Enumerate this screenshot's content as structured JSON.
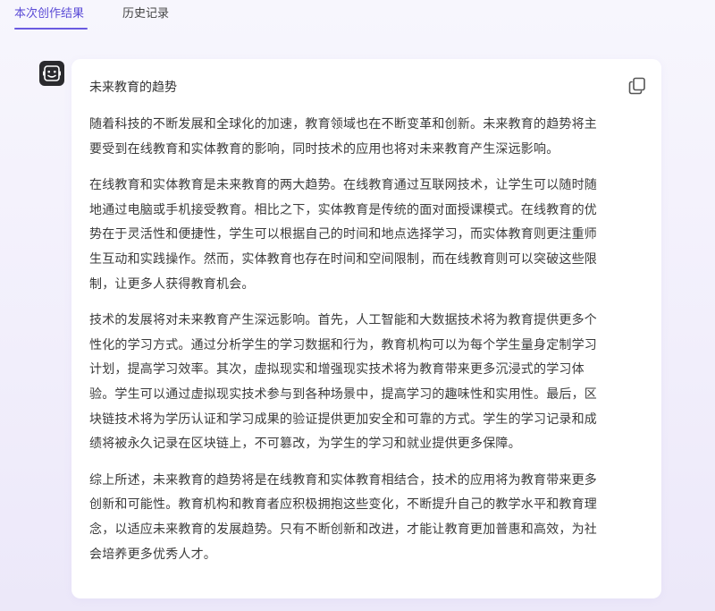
{
  "tabs": [
    {
      "label": "本次创作结果",
      "active": true
    },
    {
      "label": "历史记录",
      "active": false
    }
  ],
  "accent_color": "#6a5ae0",
  "result": {
    "title": "未来教育的趋势",
    "paragraphs": [
      "随着科技的不断发展和全球化的加速，教育领域也在不断变革和创新。未来教育的趋势将主要受到在线教育和实体教育的影响，同时技术的应用也将对未来教育产生深远影响。",
      "在线教育和实体教育是未来教育的两大趋势。在线教育通过互联网技术，让学生可以随时随地通过电脑或手机接受教育。相比之下，实体教育是传统的面对面授课模式。在线教育的优势在于灵活性和便捷性，学生可以根据自己的时间和地点选择学习，而实体教育则更注重师生互动和实践操作。然而，实体教育也存在时间和空间限制，而在线教育则可以突破这些限制，让更多人获得教育机会。",
      "技术的发展将对未来教育产生深远影响。首先，人工智能和大数据技术将为教育提供更多个性化的学习方式。通过分析学生的学习数据和行为，教育机构可以为每个学生量身定制学习计划，提高学习效率。其次，虚拟现实和增强现实技术将为教育带来更多沉浸式的学习体验。学生可以通过虚拟现实技术参与到各种场景中，提高学习的趣味性和实用性。最后，区块链技术将为学历认证和学习成果的验证提供更加安全和可靠的方式。学生的学习记录和成绩将被永久记录在区块链上，不可篡改，为学生的学习和就业提供更多保障。",
      "综上所述，未来教育的趋势将是在线教育和实体教育相结合，技术的应用将为教育带来更多创新和可能性。教育机构和教育者应积极拥抱这些变化，不断提升自己的教学水平和教育理念，以适应未来教育的发展趋势。只有不断创新和改进，才能让教育更加普惠和高效，为社会培养更多优秀人才。"
    ]
  },
  "icons": {
    "avatar": "robot-face-icon",
    "copy": "copy-icon"
  }
}
